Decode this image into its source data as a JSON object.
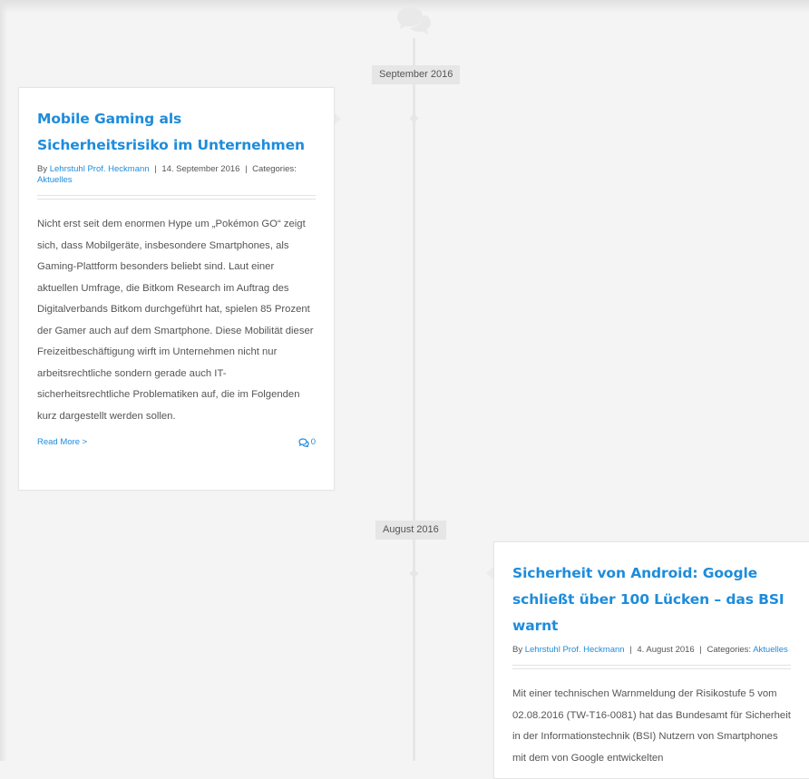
{
  "timeline": {
    "icon": "comments-icon",
    "months": [
      "September 2016",
      "August 2016"
    ]
  },
  "posts": [
    {
      "title": "Mobile Gaming als Sicherheitsrisiko im Unternehmen",
      "by_label": "By",
      "author": "Lehrstuhl Prof. Heckmann",
      "separator": "|",
      "date": "14. September 2016",
      "categories_label": "Categories:",
      "category": "Aktuelles",
      "excerpt": "Nicht erst seit dem enormen Hype um „Pokémon GO“ zeigt sich, dass Mobilgeräte, insbesondere Smartphones, als Gaming-Plattform besonders beliebt sind. Laut einer aktuellen Umfrage, die Bitkom Research im Auftrag des Digitalverbands Bitkom durchgeführt hat, spielen 85 Prozent der Gamer auch auf dem Smartphone. Diese Mobilität dieser Freizeitbeschäftigung wirft im Unternehmen nicht nur arbeitsrechtliche sondern gerade auch IT-sicherheitsrechtliche Problematiken auf, die im Folgenden kurz dargestellt werden sollen.",
      "read_more": "Read More >",
      "comment_count": "0"
    },
    {
      "title": "Sicherheit von Android: Google schließt über 100 Lücken – das BSI warnt",
      "by_label": "By",
      "author": "Lehrstuhl Prof. Heckmann",
      "separator": "|",
      "date": "4. August 2016",
      "categories_label": "Categories:",
      "category": "Aktuelles",
      "excerpt": "Mit einer technischen Warnmeldung der Risikostufe 5 vom 02.08.2016 (TW-T16-0081) hat das Bundesamt für Sicherheit in der Informationstechnik (BSI) Nutzern von Smartphones mit dem von Google entwickelten"
    }
  ],
  "colors": {
    "accent": "#1e8cdb",
    "text": "#555555",
    "timeline": "#e6e6e6",
    "background": "#f4f4f4"
  }
}
